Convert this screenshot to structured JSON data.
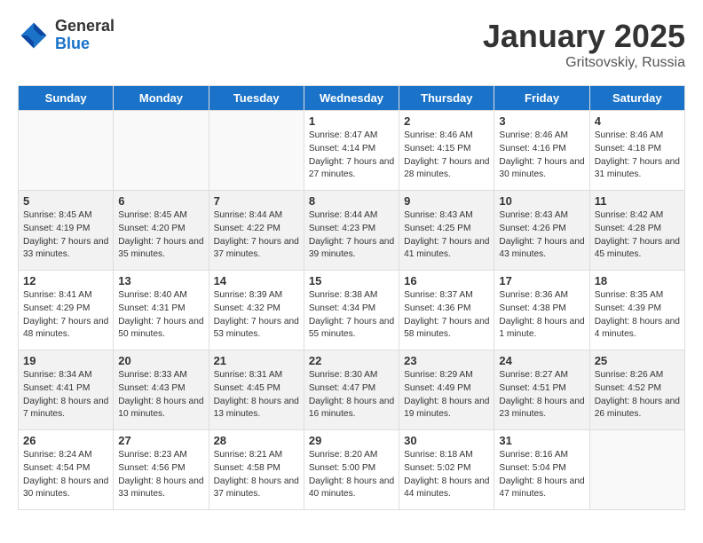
{
  "header": {
    "logo_general": "General",
    "logo_blue": "Blue",
    "month_title": "January 2025",
    "location": "Gritsovskiy, Russia"
  },
  "weekdays": [
    "Sunday",
    "Monday",
    "Tuesday",
    "Wednesday",
    "Thursday",
    "Friday",
    "Saturday"
  ],
  "weeks": [
    [
      {
        "day": "",
        "content": ""
      },
      {
        "day": "",
        "content": ""
      },
      {
        "day": "",
        "content": ""
      },
      {
        "day": "1",
        "content": "Sunrise: 8:47 AM\nSunset: 4:14 PM\nDaylight: 7 hours and 27 minutes."
      },
      {
        "day": "2",
        "content": "Sunrise: 8:46 AM\nSunset: 4:15 PM\nDaylight: 7 hours and 28 minutes."
      },
      {
        "day": "3",
        "content": "Sunrise: 8:46 AM\nSunset: 4:16 PM\nDaylight: 7 hours and 30 minutes."
      },
      {
        "day": "4",
        "content": "Sunrise: 8:46 AM\nSunset: 4:18 PM\nDaylight: 7 hours and 31 minutes."
      }
    ],
    [
      {
        "day": "5",
        "content": "Sunrise: 8:45 AM\nSunset: 4:19 PM\nDaylight: 7 hours and 33 minutes."
      },
      {
        "day": "6",
        "content": "Sunrise: 8:45 AM\nSunset: 4:20 PM\nDaylight: 7 hours and 35 minutes."
      },
      {
        "day": "7",
        "content": "Sunrise: 8:44 AM\nSunset: 4:22 PM\nDaylight: 7 hours and 37 minutes."
      },
      {
        "day": "8",
        "content": "Sunrise: 8:44 AM\nSunset: 4:23 PM\nDaylight: 7 hours and 39 minutes."
      },
      {
        "day": "9",
        "content": "Sunrise: 8:43 AM\nSunset: 4:25 PM\nDaylight: 7 hours and 41 minutes."
      },
      {
        "day": "10",
        "content": "Sunrise: 8:43 AM\nSunset: 4:26 PM\nDaylight: 7 hours and 43 minutes."
      },
      {
        "day": "11",
        "content": "Sunrise: 8:42 AM\nSunset: 4:28 PM\nDaylight: 7 hours and 45 minutes."
      }
    ],
    [
      {
        "day": "12",
        "content": "Sunrise: 8:41 AM\nSunset: 4:29 PM\nDaylight: 7 hours and 48 minutes."
      },
      {
        "day": "13",
        "content": "Sunrise: 8:40 AM\nSunset: 4:31 PM\nDaylight: 7 hours and 50 minutes."
      },
      {
        "day": "14",
        "content": "Sunrise: 8:39 AM\nSunset: 4:32 PM\nDaylight: 7 hours and 53 minutes."
      },
      {
        "day": "15",
        "content": "Sunrise: 8:38 AM\nSunset: 4:34 PM\nDaylight: 7 hours and 55 minutes."
      },
      {
        "day": "16",
        "content": "Sunrise: 8:37 AM\nSunset: 4:36 PM\nDaylight: 7 hours and 58 minutes."
      },
      {
        "day": "17",
        "content": "Sunrise: 8:36 AM\nSunset: 4:38 PM\nDaylight: 8 hours and 1 minute."
      },
      {
        "day": "18",
        "content": "Sunrise: 8:35 AM\nSunset: 4:39 PM\nDaylight: 8 hours and 4 minutes."
      }
    ],
    [
      {
        "day": "19",
        "content": "Sunrise: 8:34 AM\nSunset: 4:41 PM\nDaylight: 8 hours and 7 minutes."
      },
      {
        "day": "20",
        "content": "Sunrise: 8:33 AM\nSunset: 4:43 PM\nDaylight: 8 hours and 10 minutes."
      },
      {
        "day": "21",
        "content": "Sunrise: 8:31 AM\nSunset: 4:45 PM\nDaylight: 8 hours and 13 minutes."
      },
      {
        "day": "22",
        "content": "Sunrise: 8:30 AM\nSunset: 4:47 PM\nDaylight: 8 hours and 16 minutes."
      },
      {
        "day": "23",
        "content": "Sunrise: 8:29 AM\nSunset: 4:49 PM\nDaylight: 8 hours and 19 minutes."
      },
      {
        "day": "24",
        "content": "Sunrise: 8:27 AM\nSunset: 4:51 PM\nDaylight: 8 hours and 23 minutes."
      },
      {
        "day": "25",
        "content": "Sunrise: 8:26 AM\nSunset: 4:52 PM\nDaylight: 8 hours and 26 minutes."
      }
    ],
    [
      {
        "day": "26",
        "content": "Sunrise: 8:24 AM\nSunset: 4:54 PM\nDaylight: 8 hours and 30 minutes."
      },
      {
        "day": "27",
        "content": "Sunrise: 8:23 AM\nSunset: 4:56 PM\nDaylight: 8 hours and 33 minutes."
      },
      {
        "day": "28",
        "content": "Sunrise: 8:21 AM\nSunset: 4:58 PM\nDaylight: 8 hours and 37 minutes."
      },
      {
        "day": "29",
        "content": "Sunrise: 8:20 AM\nSunset: 5:00 PM\nDaylight: 8 hours and 40 minutes."
      },
      {
        "day": "30",
        "content": "Sunrise: 8:18 AM\nSunset: 5:02 PM\nDaylight: 8 hours and 44 minutes."
      },
      {
        "day": "31",
        "content": "Sunrise: 8:16 AM\nSunset: 5:04 PM\nDaylight: 8 hours and 47 minutes."
      },
      {
        "day": "",
        "content": ""
      }
    ]
  ]
}
